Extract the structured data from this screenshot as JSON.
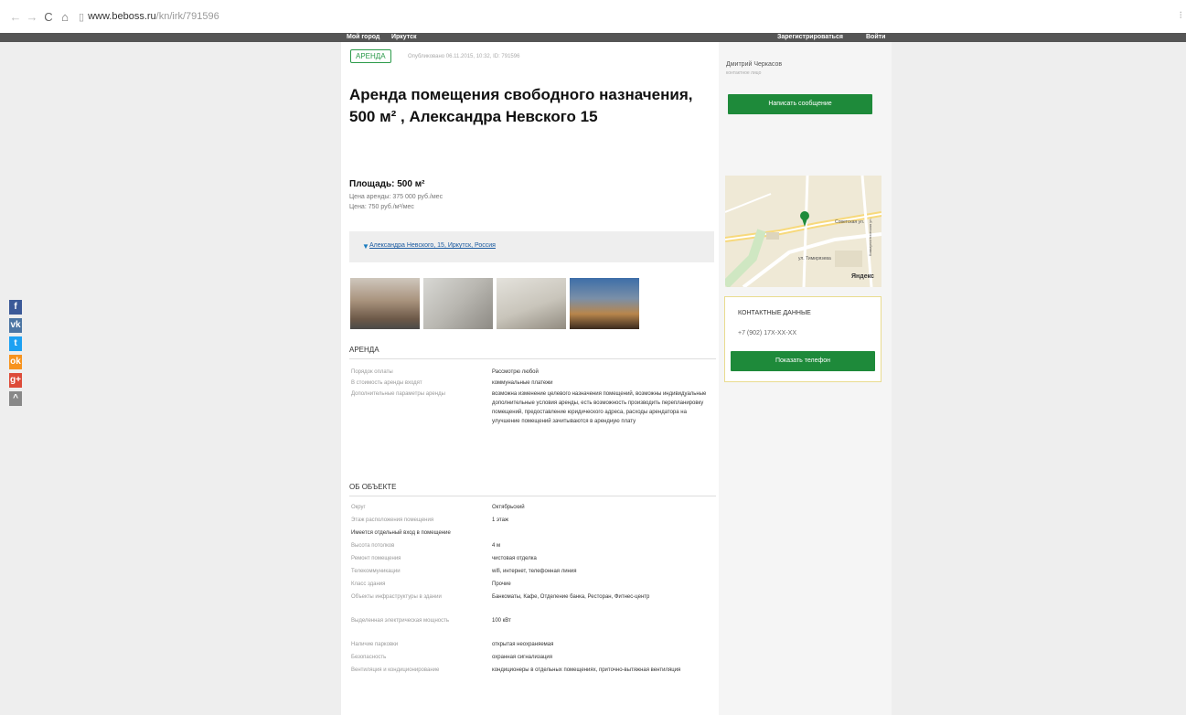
{
  "browser": {
    "nav": {
      "back": "←",
      "forward": "→",
      "reload": "C",
      "home": "⌂"
    },
    "url_host": "www.beboss.ru",
    "url_path": "/kn/irk/791596",
    "menu": "⁝"
  },
  "topnav": {
    "left1": "Мой город",
    "left2": "Иркутск",
    "right1": "Зарегистрироваться",
    "right2": "Войти"
  },
  "social": [
    {
      "icon": "facebook-icon",
      "glyph": "f",
      "color": "#3b5998"
    },
    {
      "icon": "vk-icon",
      "glyph": "vk",
      "color": "#4c75a3"
    },
    {
      "icon": "twitter-icon",
      "glyph": "t",
      "color": "#1da1f2"
    },
    {
      "icon": "odnoklassniki-icon",
      "glyph": "ok",
      "color": "#f7931e"
    },
    {
      "icon": "google-plus-icon",
      "glyph": "g+",
      "color": "#dd4b39"
    },
    {
      "icon": "more-share-icon",
      "glyph": "^",
      "color": "#888888"
    }
  ],
  "listing": {
    "badge": "АРЕНДА",
    "published": "Опубликовано 06.11.2015, 10:32, ID: 791596",
    "title": "Аренда помещения свободного назначения, 500 м² , Александра Невского 15",
    "area": "Площадь: 500 м²",
    "rent_price": "Цена аренды: 375 000 руб./мес",
    "price_per_m": "Цена: 750 руб./м²/мес",
    "address": "Александра Невского, 15, Иркутск, Россия"
  },
  "photos": [
    {
      "name": "photo-building",
      "bg": "linear-gradient(180deg,#cfc7bd 0%,#a8927c 45%,#6d5948 80%,#4a4a48 100%)"
    },
    {
      "name": "photo-interior-1",
      "bg": "linear-gradient(135deg,#d8d8d4 0%,#b9b7b1 50%,#8d8a84 100%)"
    },
    {
      "name": "photo-interior-2",
      "bg": "linear-gradient(160deg,#e4e2dc 0%,#c9c5bb 55%,#918b80 100%)"
    },
    {
      "name": "photo-exterior-night",
      "bg": "linear-gradient(180deg,#3d6ea8 0%,#7a8fa8 40%,#b8864c 70%,#3a2a1e 100%)"
    }
  ],
  "rent_section": {
    "heading": "АРЕНДА",
    "rows": [
      {
        "label": "Порядок оплаты",
        "value": "Рассмотрю любой"
      },
      {
        "label": "В стоимость аренды входят",
        "value": "коммунальные платежи"
      },
      {
        "label": "Дополнительные параметры аренды",
        "value": "возможна изменение целевого назначения помещений, возможны индивидуальные дополнительные условия аренды, есть возможность производить перепланировку помещений, предоставление юридического адреса, расходы арендатора на улучшение помещений зачитываются в арендную плату"
      }
    ]
  },
  "object_section": {
    "heading": "ОБ ОБЪЕКТЕ",
    "rows": [
      {
        "label": "Округ",
        "value": "Октябрьский"
      },
      {
        "label": "Этаж расположения помещения",
        "value": "1 этаж"
      },
      {
        "full": "Имеется отдельный вход в помещение"
      },
      {
        "label": "Высота потолков",
        "value": "4 м"
      },
      {
        "label": "Ремонт помещения",
        "value": "чистовая отделка"
      },
      {
        "label": "Телекоммуникации",
        "value": "wifi, интернет, телефонная линия"
      },
      {
        "label": "Класс здания",
        "value": "Прочие"
      },
      {
        "label": "Объекты инфраструктуры в здании",
        "value": "Банкоматы, Кафе, Отделение банка, Ресторан, Фитнес-центр"
      },
      {
        "label": "Выделенная электрическая мощность",
        "value": "100 кВт"
      },
      {
        "label": "Наличие парковки",
        "value": "открытая неохраняемая"
      },
      {
        "label": "Безопасность",
        "value": "охранная сигнализация"
      },
      {
        "label": "Вентиляция и кондиционирование",
        "value": "кондиционеры в отдельных помещениях, приточно-вытяжная вентиляция"
      }
    ]
  },
  "agent": {
    "name": "Дмитрий Черкасов",
    "role": "контактное лицо",
    "message_button": "Написать сообщение"
  },
  "map": {
    "streets": [
      "Советская ул.",
      "ул. Тимирязева",
      "Коммунистическая ул."
    ],
    "logo": "Яндекс"
  },
  "contacts": {
    "heading": "КОНТАКТНЫЕ ДАННЫЕ",
    "phone": "+7 (902) 17X-XX-XX",
    "show_phone_button": "Показать телефон"
  },
  "colors": {
    "green": "#1e8a3a",
    "badge_green": "#2b9a4a",
    "topbar": "#555555"
  }
}
